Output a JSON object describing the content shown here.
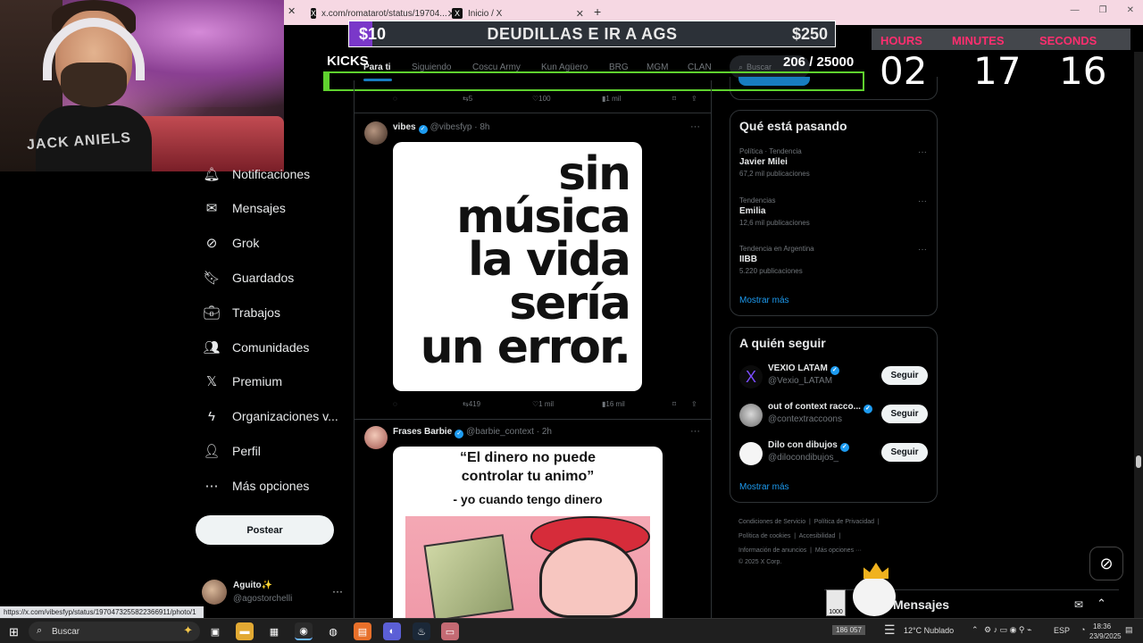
{
  "browser": {
    "tabs": [
      {
        "label": "x.com/romatarot/status/19704...",
        "icon": "x-logo-icon"
      },
      {
        "label": "Inicio / X",
        "icon": "x-logo-icon"
      }
    ],
    "status_url": "https://x.com/vibesfyp/status/1970473255822366911/photo/1"
  },
  "overlay": {
    "banner_left": "$10",
    "banner_mid": "DEUDILLAS E IR A AGS",
    "banner_right": "$250",
    "kicks_label": "KICKS",
    "kicks_count": "206  / 25000",
    "kicks_progress": 0.008,
    "countdown": {
      "hours_label": "HOURS",
      "minutes_label": "MINUTES",
      "seconds_label": "SECONDS",
      "hours": "02",
      "minutes": "17",
      "seconds": "16"
    }
  },
  "colors": {
    "accent": "#1d9bf0",
    "kicks_green": "#5fd12e",
    "overlay_purple": "#7a38c9",
    "countdown_pink": "#ff2e6f"
  },
  "webcam": {
    "shirt_text": "JACK ANIELS"
  },
  "timeline_tabs": [
    "Para ti",
    "Siguiendo",
    "Coscu Army",
    "Kun Agüero",
    "BRG",
    "MGM",
    "CLAN"
  ],
  "search": {
    "placeholder": "Buscar"
  },
  "nav": {
    "items": [
      {
        "label": "Notificaciones",
        "icon": "bell-icon"
      },
      {
        "label": "Mensajes",
        "icon": "mail-icon"
      },
      {
        "label": "Grok",
        "icon": "grok-icon"
      },
      {
        "label": "Guardados",
        "icon": "bookmark-icon"
      },
      {
        "label": "Trabajos",
        "icon": "briefcase-icon"
      },
      {
        "label": "Comunidades",
        "icon": "people-icon"
      },
      {
        "label": "Premium",
        "icon": "x-logo-icon"
      },
      {
        "label": "Organizaciones v...",
        "icon": "lightning-icon"
      },
      {
        "label": "Perfil",
        "icon": "person-icon"
      },
      {
        "label": "Más opciones",
        "icon": "more-circle-icon"
      }
    ],
    "post_button": "Postear",
    "account": {
      "name": "Aguito✨",
      "handle": "@agostorchelli"
    }
  },
  "feed": {
    "prev_actions": {
      "reposts": "5",
      "likes": "100",
      "views": "1 mil"
    },
    "tweets": [
      {
        "name": "vibes",
        "handle": "@vibesfyp",
        "time": "8h",
        "image_lines": [
          "sin",
          "música",
          "la vida",
          "sería",
          "un error."
        ],
        "reposts": "419",
        "likes": "1 mil",
        "views": "16 mil"
      },
      {
        "name": "Frases Barbie",
        "handle": "@barbie_context",
        "time": "2h",
        "image_quote": [
          "“El dinero no puede",
          "controlar tu animo”"
        ],
        "image_sub": "- yo cuando tengo dinero"
      }
    ]
  },
  "trends": {
    "title": "Qué está pasando",
    "items": [
      {
        "context": "Política · Tendencia",
        "topic": "Javier Milei",
        "posts": "67,2 mil publicaciones"
      },
      {
        "context": "Tendencias",
        "topic": "Emilia",
        "posts": "12,6 mil publicaciones"
      },
      {
        "context": "Tendencia en Argentina",
        "topic": "IIBB",
        "posts": "5.220 publicaciones"
      }
    ],
    "more": "Mostrar más"
  },
  "who_to_follow": {
    "title": "A quién seguir",
    "items": [
      {
        "name": "VEXIO LATAM",
        "handle": "@Vexio_LATAM",
        "button": "Seguir"
      },
      {
        "name": "out of context racco...",
        "handle": "@contextraccoons",
        "button": "Seguir"
      },
      {
        "name": "Dilo con dibujos",
        "handle": "@dilocondibujos_",
        "button": "Seguir"
      }
    ],
    "more": "Mostrar más"
  },
  "footer": {
    "links": [
      "Condiciones de Servicio",
      "Política de Privacidad",
      "Política de cookies",
      "Accesibilidad",
      "Información de anuncios",
      "Más opciones ···"
    ],
    "copyright": "© 2025 X Corp."
  },
  "messages_drawer": {
    "title": "Mensajes"
  },
  "sticker": {
    "box_text": "1000"
  },
  "taskbar": {
    "search_placeholder": "Buscar",
    "tray_counter": "186 057",
    "weather": "12°C  Nublado",
    "lang": "ESP",
    "time": "18:36",
    "date": "23/9/2025"
  }
}
